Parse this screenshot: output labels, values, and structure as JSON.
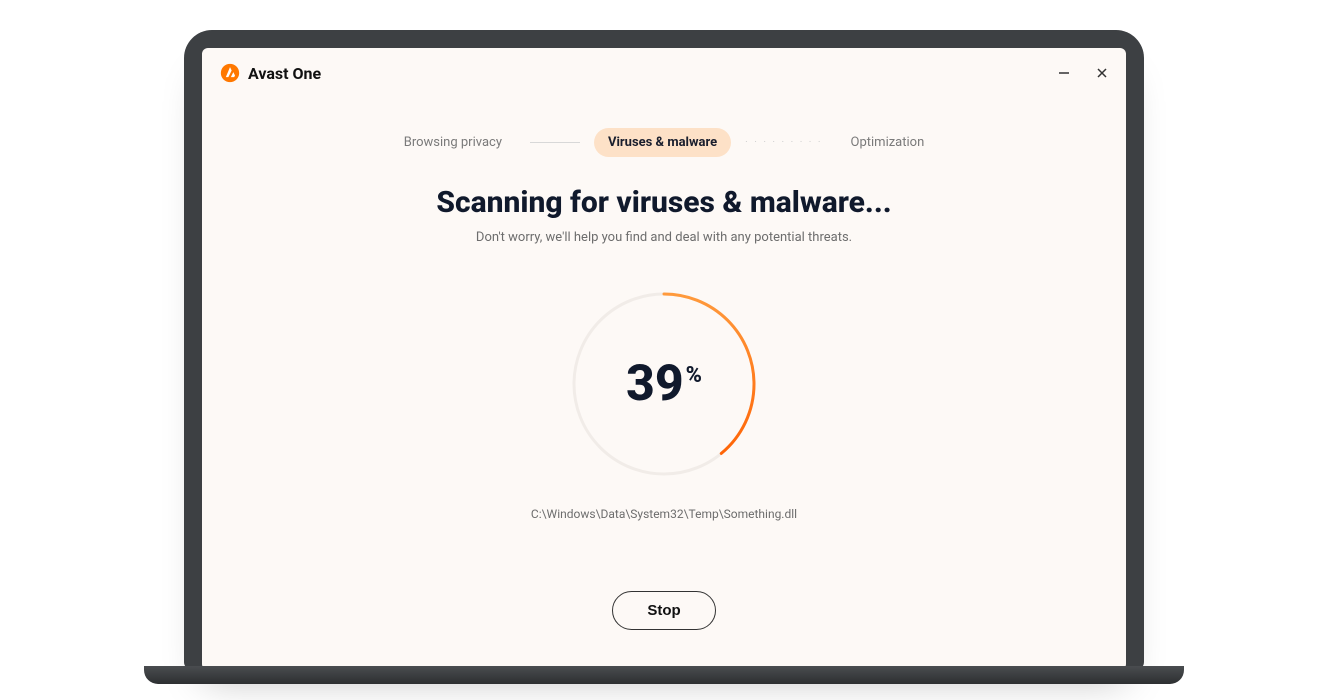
{
  "app": {
    "title": "Avast One"
  },
  "steps": {
    "browsing": "Browsing privacy",
    "viruses": "Viruses & malware",
    "optimization": "Optimization"
  },
  "headline": "Scanning for viruses & malware...",
  "subtext": "Don't worry, we'll help you find and deal with any potential threats.",
  "progress": {
    "percent": "39",
    "symbol": "%",
    "circumference": 565.49,
    "dashoffset": 344.95
  },
  "filepath": "C:\\Windows\\Data\\System32\\Temp\\Something.dll",
  "buttons": {
    "stop": "Stop"
  },
  "colors": {
    "accent_start": "#ff5e00",
    "accent_end": "#ff8a00",
    "pill": "#fde1c7"
  }
}
